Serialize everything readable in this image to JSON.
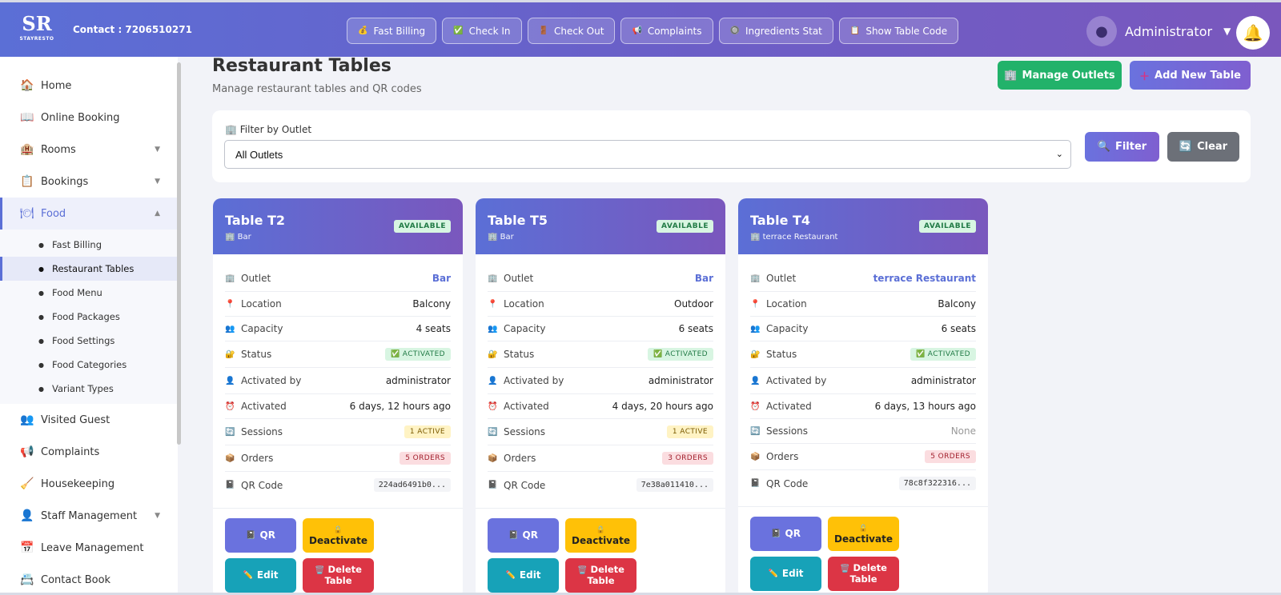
{
  "header": {
    "logo_mark": "SR",
    "logo_text": "STAYRESTO",
    "contact": "Contact : 7206510271",
    "quick_actions": [
      {
        "label": "Fast Billing",
        "icon": "💰"
      },
      {
        "label": "Check In",
        "icon": "✅"
      },
      {
        "label": "Check Out",
        "icon": "🚪"
      },
      {
        "label": "Complaints",
        "icon": "📢"
      },
      {
        "label": "Ingredients Stat",
        "icon": "🔘"
      },
      {
        "label": "Show Table Code",
        "icon": "📋"
      }
    ],
    "user_name": "Administrator"
  },
  "sidebar": {
    "items": [
      {
        "label": "Home",
        "icon": "🏠"
      },
      {
        "label": "Online Booking",
        "icon": "📖"
      },
      {
        "label": "Rooms",
        "icon": "🏨",
        "arrow": "▼"
      },
      {
        "label": "Bookings",
        "icon": "📋",
        "arrow": "▼"
      },
      {
        "label": "Food",
        "icon": "🍽",
        "arrow": "▲"
      }
    ],
    "food_sub": [
      "Fast Billing",
      "Restaurant Tables",
      "Food Menu",
      "Food Packages",
      "Food Settings",
      "Food Categories",
      "Variant Types"
    ],
    "items_after": [
      {
        "label": "Visited Guest",
        "icon": "👥"
      },
      {
        "label": "Complaints",
        "icon": "📢"
      },
      {
        "label": "Housekeeping",
        "icon": "🧹"
      },
      {
        "label": "Staff Management",
        "icon": "👤",
        "arrow": "▼"
      },
      {
        "label": "Leave Management",
        "icon": "📅"
      },
      {
        "label": "Contact Book",
        "icon": "📇"
      }
    ]
  },
  "main": {
    "title": "Restaurant Tables",
    "subtitle": "Manage restaurant tables and QR codes",
    "manage_outlets": "Manage Outlets",
    "add_table": "Add New Table",
    "filter_label": "Filter by Outlet",
    "filter_value": "All Outlets",
    "filter_btn": "Filter",
    "clear_btn": "Clear"
  },
  "labels": {
    "outlet": "Outlet",
    "location": "Location",
    "capacity": "Capacity",
    "status": "Status",
    "activated_by": "Activated by",
    "activated": "Activated",
    "sessions": "Sessions",
    "orders": "Orders",
    "qr_code": "QR Code",
    "available": "AVAILABLE",
    "btn_qr": "QR",
    "btn_deactivate": "Deactivate",
    "btn_edit": "Edit",
    "btn_delete_1": "Delete",
    "btn_delete_2": "Table"
  },
  "tables": [
    {
      "name": "Table T2",
      "outlet": "Bar",
      "location": "Balcony",
      "capacity": "4 seats",
      "status": "✅ ACTIVATED",
      "activated_by": "administrator",
      "activated": "6 days, 12 hours ago",
      "sessions": "1 ACTIVE",
      "orders": "5 ORDERS",
      "qr": "224ad6491b0..."
    },
    {
      "name": "Table T5",
      "outlet": "Bar",
      "location": "Outdoor",
      "capacity": "6 seats",
      "status": "✅ ACTIVATED",
      "activated_by": "administrator",
      "activated": "4 days, 20 hours ago",
      "sessions": "1 ACTIVE",
      "orders": "3 ORDERS",
      "qr": "7e38a011410..."
    },
    {
      "name": "Table T4",
      "outlet": "terrace Restaurant",
      "location": "Balcony",
      "capacity": "6 seats",
      "status": "✅ ACTIVATED",
      "activated_by": "administrator",
      "activated": "6 days, 13 hours ago",
      "sessions": "None",
      "orders": "5 ORDERS",
      "qr": "78c8f322316..."
    }
  ]
}
